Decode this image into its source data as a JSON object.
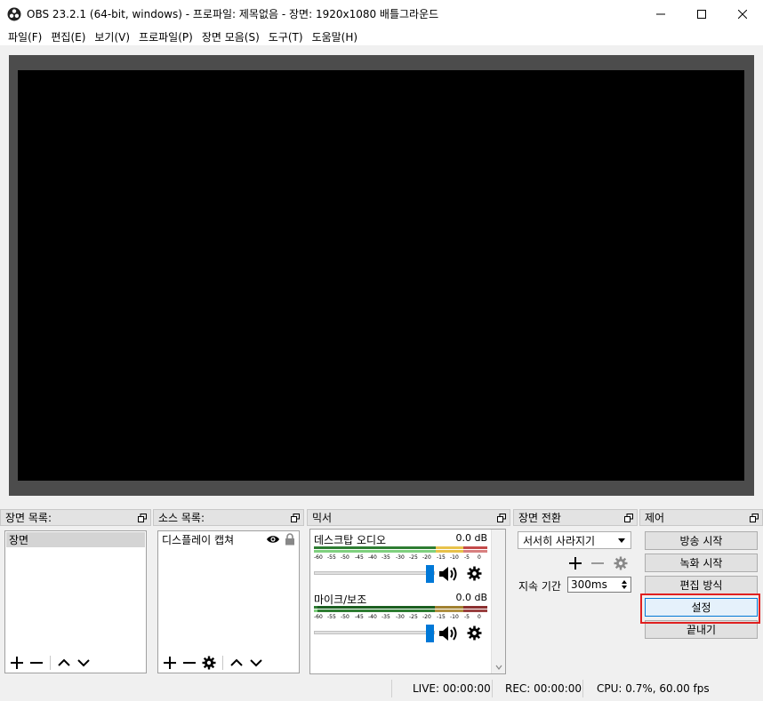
{
  "window": {
    "title": "OBS 23.2.1 (64-bit, windows) - 프로파일: 제목없음 - 장면: 1920x1080 배틀그라운드"
  },
  "menu": [
    "파일(F)",
    "편집(E)",
    "보기(V)",
    "프로파일(P)",
    "장면 모음(S)",
    "도구(T)",
    "도움말(H)"
  ],
  "scenes": {
    "title": "장면 목록:",
    "items": [
      "장면"
    ]
  },
  "sources": {
    "title": "소스 목록:",
    "items": [
      {
        "name": "디스플레이 캡쳐",
        "visible": true,
        "locked": true
      }
    ]
  },
  "mixer": {
    "title": "믹서",
    "scale": [
      "-60",
      "-55",
      "-50",
      "-45",
      "-40",
      "-35",
      "-30",
      "-25",
      "-20",
      "-15",
      "-10",
      "-5",
      "0"
    ],
    "channels": [
      {
        "name": "데스크탑 오디오",
        "db": "0.0 dB",
        "volume": 1.0
      },
      {
        "name": "마이크/보조",
        "db": "0.0 dB",
        "volume": 1.0
      }
    ]
  },
  "transitions": {
    "title": "장면 전환",
    "selected": "서서히 사라지기",
    "duration_label": "지속 기간",
    "duration_value": "300ms"
  },
  "controls": {
    "title": "제어",
    "buttons": [
      "방송 시작",
      "녹화 시작",
      "편집 방식",
      "설정",
      "끝내기"
    ]
  },
  "status": {
    "live": "LIVE: 00:00:00",
    "rec": "REC: 00:00:00",
    "cpu": "CPU: 0.7%, 60.00 fps"
  },
  "colors": {
    "meter_green_dark": "#2e7d32",
    "meter_green_light": "#7fd07f",
    "meter_yellow": "#e8c24a",
    "meter_red": "#c44a4a",
    "accent": "#0078d7",
    "highlight_red": "#e02020"
  }
}
